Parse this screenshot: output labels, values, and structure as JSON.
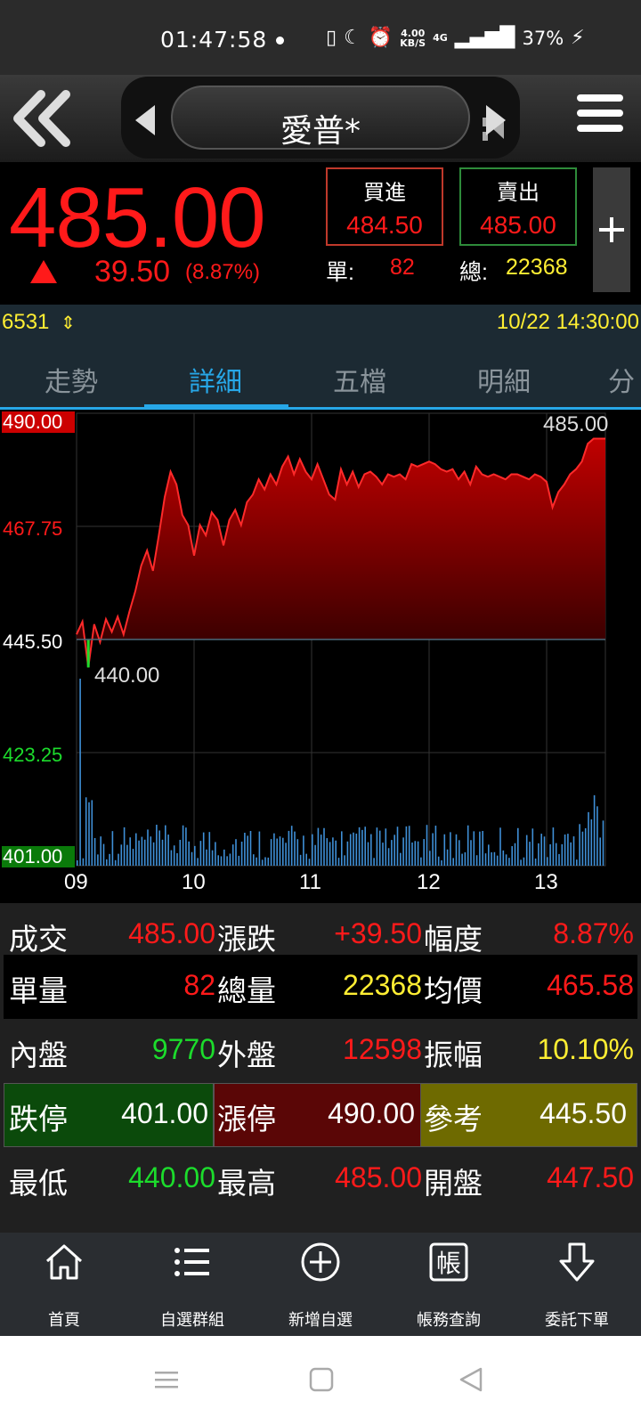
{
  "status_bar": {
    "time": "01:47:58",
    "net_speed_value": "4.00",
    "net_speed_unit": "KB/S",
    "network": "4G",
    "battery": "37%"
  },
  "nav": {
    "stock_name": "愛普*"
  },
  "quote": {
    "price": "485.00",
    "change": "39.50",
    "change_pct": "(8.87%)",
    "buy_label": "買進",
    "buy_price": "484.50",
    "sell_label": "賣出",
    "sell_price": "485.00",
    "single_label": "單:",
    "single_volume": "82",
    "total_label": "總:",
    "total_volume": "22368"
  },
  "info_strip": {
    "code": "6531",
    "datetime": "10/22 14:30:00"
  },
  "tabs": [
    "走勢",
    "詳細",
    "五檔",
    "明細",
    "分"
  ],
  "chart_data": {
    "type": "area",
    "y_ticks": [
      "490.00",
      "467.75",
      "445.50",
      "423.25",
      "401.00"
    ],
    "x_ticks": [
      "09",
      "10",
      "11",
      "12",
      "13"
    ],
    "ylim": [
      401.0,
      490.0
    ],
    "reference": 445.5,
    "high_label": "485.00",
    "low_label": "440.00",
    "x": [
      9.0,
      9.05,
      9.1,
      9.15,
      9.2,
      9.25,
      9.3,
      9.35,
      9.4,
      9.45,
      9.5,
      9.55,
      9.6,
      9.65,
      9.7,
      9.75,
      9.8,
      9.85,
      9.9,
      9.95,
      10.0,
      10.05,
      10.1,
      10.15,
      10.2,
      10.25,
      10.3,
      10.35,
      10.4,
      10.45,
      10.5,
      10.55,
      10.6,
      10.65,
      10.7,
      10.75,
      10.8,
      10.85,
      10.9,
      10.95,
      11.0,
      11.05,
      11.1,
      11.15,
      11.2,
      11.25,
      11.3,
      11.35,
      11.4,
      11.45,
      11.5,
      11.55,
      11.6,
      11.65,
      11.7,
      11.75,
      11.8,
      11.85,
      11.9,
      11.95,
      12.0,
      12.05,
      12.1,
      12.15,
      12.2,
      12.25,
      12.3,
      12.35,
      12.4,
      12.45,
      12.5,
      12.55,
      12.6,
      12.65,
      12.7,
      12.75,
      12.8,
      12.85,
      12.9,
      12.95,
      13.0,
      13.05,
      13.1,
      13.15,
      13.2,
      13.25,
      13.3,
      13.35,
      13.4,
      13.45,
      13.5
    ],
    "values": [
      446.5,
      449.0,
      440.0,
      448.5,
      445.0,
      449.5,
      447.0,
      450.0,
      446.5,
      451.0,
      455.0,
      460.0,
      463.0,
      459.0,
      466.0,
      473.5,
      478.5,
      476.0,
      470.0,
      468.0,
      462.0,
      468.0,
      466.0,
      470.5,
      469.0,
      464.0,
      469.0,
      471.0,
      468.0,
      472.5,
      474.0,
      477.0,
      475.0,
      478.0,
      476.0,
      479.5,
      481.5,
      478.0,
      481.0,
      478.5,
      477.0,
      480.0,
      477.0,
      474.0,
      473.0,
      479.0,
      476.0,
      478.5,
      475.5,
      478.0,
      478.5,
      477.5,
      476.0,
      478.0,
      477.5,
      478.0,
      477.0,
      480.0,
      479.5,
      480.0,
      480.5,
      480.0,
      479.0,
      478.5,
      479.0,
      477.0,
      478.5,
      476.0,
      479.5,
      478.0,
      477.5,
      478.0,
      477.5,
      477.0,
      478.0,
      478.0,
      477.5,
      477.0,
      478.0,
      477.5,
      476.5,
      471.5,
      474.5,
      476.0,
      478.0,
      479.0,
      480.5,
      484.0,
      485.0,
      485.0,
      485.0
    ],
    "volume_scale_note": ""
  },
  "grid": [
    [
      {
        "label": "成交",
        "value": "485.00",
        "color": "#ff1a1a"
      },
      {
        "label": "漲跌",
        "value": "+39.50",
        "color": "#ff1a1a"
      },
      {
        "label": "幅度",
        "value": "8.87%",
        "color": "#ff1a1a"
      }
    ],
    [
      {
        "label": "單量",
        "value": "82",
        "color": "#ff1a1a"
      },
      {
        "label": "總量",
        "value": "22368",
        "color": "#ffee33"
      },
      {
        "label": "均價",
        "value": "465.58",
        "color": "#ff1a1a"
      }
    ],
    [
      {
        "label": "內盤",
        "value": "9770",
        "color": "#1cdc2c"
      },
      {
        "label": "外盤",
        "value": "12598",
        "color": "#ff1a1a"
      },
      {
        "label": "振幅",
        "value": "10.10%",
        "color": "#ffee33"
      }
    ],
    [
      {
        "label": "跌停",
        "value": "401.00",
        "color": "#ffffff"
      },
      {
        "label": "漲停",
        "value": "490.00",
        "color": "#ffffff"
      },
      {
        "label": "參考",
        "value": "445.50",
        "color": "#ffffff"
      }
    ],
    [
      {
        "label": "最低",
        "value": "440.00",
        "color": "#1cdc2c"
      },
      {
        "label": "最高",
        "value": "485.00",
        "color": "#ff1a1a"
      },
      {
        "label": "開盤",
        "value": "447.50",
        "color": "#ff1a1a"
      }
    ]
  ],
  "bottom_nav": [
    {
      "label": "首頁",
      "icon": "home-icon"
    },
    {
      "label": "自選群組",
      "icon": "list-icon"
    },
    {
      "label": "新增自選",
      "icon": "add-circle-icon"
    },
    {
      "label": "帳務查詢",
      "icon": "account-icon",
      "glyph": "帳"
    },
    {
      "label": "委託下單",
      "icon": "order-arrow-icon"
    }
  ],
  "colors": {
    "up": "#ff1a1a",
    "down": "#1cdc2c",
    "accent": "#27a7e7",
    "volume": "#3f8fd6"
  }
}
